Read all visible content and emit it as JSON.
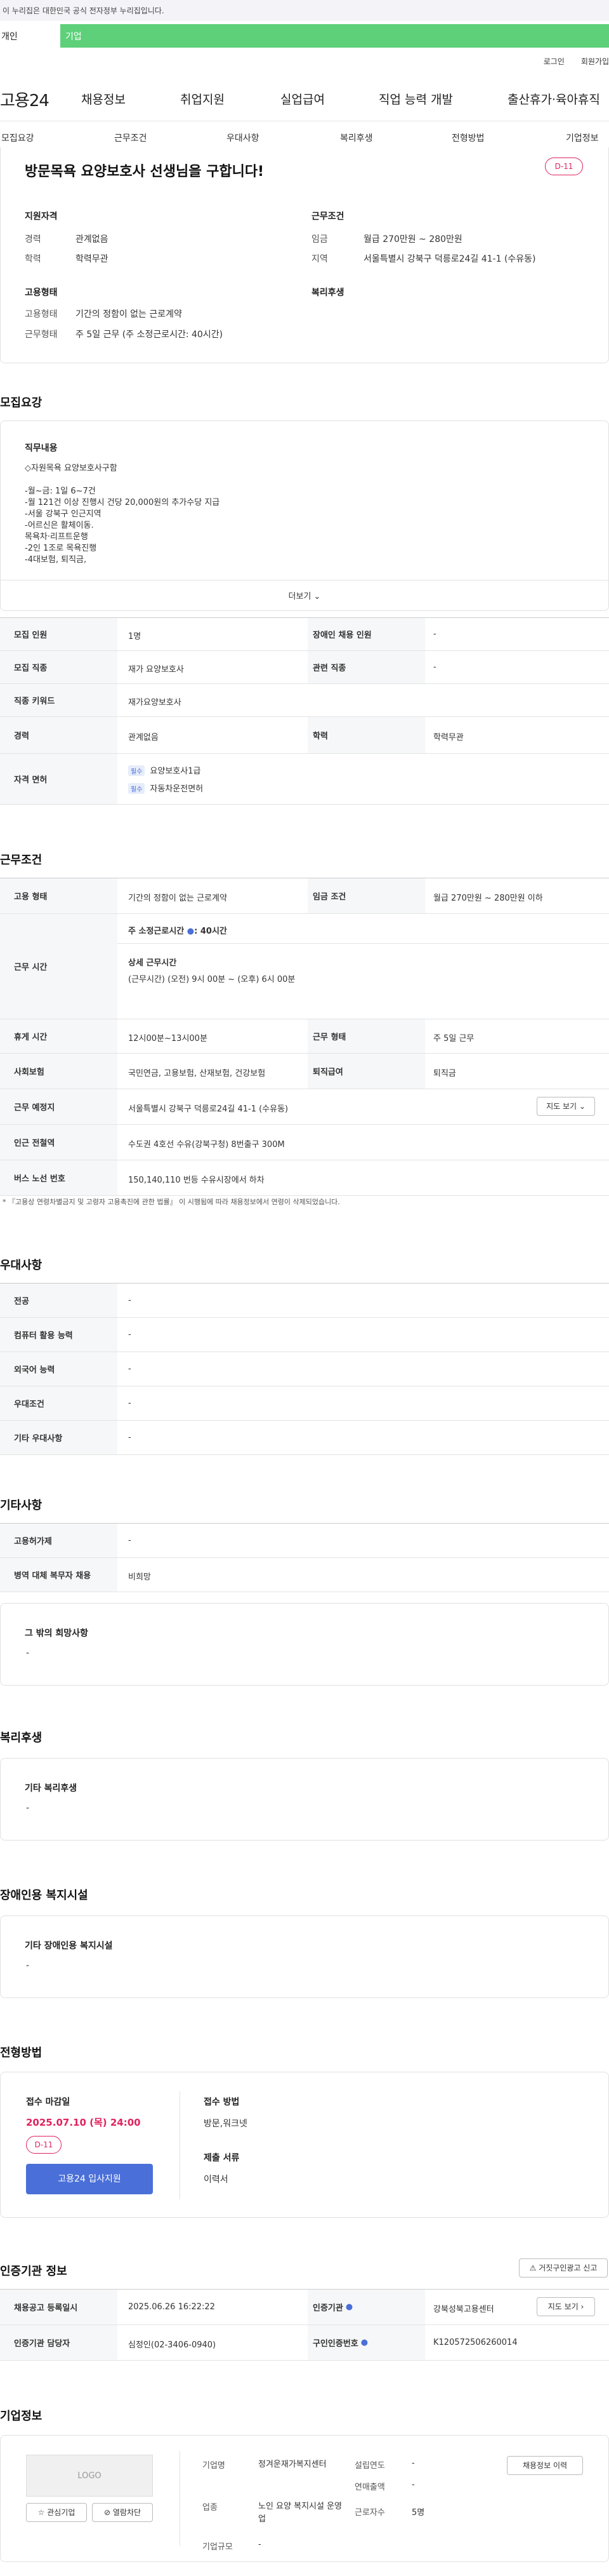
{
  "gov_banner": "이 누리집은 대한민국 공식 전자정부 누리집입니다.",
  "gnb": {
    "left": "개인",
    "right": "기업"
  },
  "util": [
    "로그인",
    "회원가입"
  ],
  "logo": "고용24",
  "menu": [
    "채용정보",
    "취업지원",
    "실업급여",
    "직업 능력 개발",
    "출산휴가·육아휴직"
  ],
  "tabs": [
    "모집요강",
    "근무조건",
    "우대사항",
    "복리후생",
    "전형방법",
    "기업정보"
  ],
  "job": {
    "title": "방문목욕 요양보호사 선생님을 구합니다!",
    "dday": "D-11",
    "qual_title": "지원자격",
    "cond_title": "근무조건",
    "emp_title": "고용형태",
    "welfare_title": "복리후생",
    "career_label": "경력",
    "career": "관계없음",
    "edu_label": "학력",
    "edu": "학력무관",
    "wage_label": "임금",
    "wage": "월급 270만원 ~ 280만원",
    "area_label": "지역",
    "area": "서울특별시 강북구 덕릉로24길 41-1 (수유동)",
    "emptype_label": "고용형태",
    "emptype": "기간의 정함이 없는 근로계약",
    "worktype_label": "근무형태",
    "worktype": "주 5일 근무 (주 소정근로시간: 40시간)"
  },
  "recruit": {
    "section": "모집요강",
    "duty_title": "직무내용",
    "duty_lines": [
      "◇자원목욕 요양보호사구함",
      "",
      "-월~금: 1일 6~7건",
      "-월 121건 이상 진행시 건당 20,000원의 추가수당 지급",
      "-서울 강북구 인근지역",
      "-어르신은 활체이동.",
      "목욕차·리프트운행",
      "-2인 1조로 목욕진행",
      "-4대보험, 퇴직금,"
    ],
    "more": "더보기",
    "rows": [
      {
        "k": "모집 인원",
        "v": "1명",
        "k2": "장애인 채용 인원",
        "v2": "-"
      },
      {
        "k": "모집 직종",
        "v": "재가 요양보호사",
        "k2": "관련 직종",
        "v2": "-"
      },
      {
        "k": "직종 키워드",
        "v": "재가요양보호사"
      },
      {
        "k": "경력",
        "v": "관계없음",
        "k2": "학력",
        "v2": "학력무관"
      }
    ],
    "license_label": "자격 면허",
    "license_badge1": "필수",
    "license1": "요양보호사1급",
    "license_badge2": "필수",
    "license2": "자동차운전면허"
  },
  "cond": {
    "section": "근무조건",
    "emp_label": "고용 형태",
    "emp": "기간의 정함이 없는 근로계약",
    "wage_label": "임금 조건",
    "wage": "월급 270만원 ~ 280만원 이하",
    "time_label": "근무 시간",
    "time_week": "주 소정근로시간",
    "time_week_val": "40시간",
    "time_detail_title": "상세 근무시간",
    "time_detail": "(근무시간) (오전) 9시 00분 ~ (오후) 6시 00분",
    "rest_label": "휴게 시간",
    "rest": "12시00분~13시00분",
    "form_label": "근무 형태",
    "form": "주 5일 근무",
    "ins_label": "사회보험",
    "ins": "국민연금, 고용보험, 산재보험, 건강보험",
    "ret_label": "퇴직급여",
    "ret": "퇴직금",
    "place_label": "근무 예정지",
    "place": "서울특별시 강북구 덕릉로24길 41-1 (수유동)",
    "map_btn": "지도 보기",
    "sub_label": "인근 전철역",
    "sub": "수도권 4호선 수유(강북구청) 8번출구 300M",
    "bus_label": "버스 노선 번호",
    "bus": "150,140,110 번등 수유시장에서 하차",
    "note": "* 『고용상 연령차별금지 및 고령자 고용촉진에 관한 법률』 이 시행됨에 따라 채용정보에서 연령이 삭제되었습니다."
  },
  "pref": {
    "section": "우대사항",
    "rows": [
      {
        "k": "전공",
        "v": "-"
      },
      {
        "k": "컴퓨터 활용 능력",
        "v": "-"
      },
      {
        "k": "외국어 능력",
        "v": "-"
      },
      {
        "k": "우대조건",
        "v": "-"
      },
      {
        "k": "기타 우대사항",
        "v": "-"
      }
    ]
  },
  "etc": {
    "section": "기타사항",
    "rows": [
      {
        "k": "고용허가제",
        "v": "-"
      },
      {
        "k": "병역 대체 복무자 채용",
        "v": "비희망"
      }
    ],
    "hope_title": "그 밖의 희망사항",
    "hope": "-"
  },
  "welfare": {
    "section": "복리후생",
    "title": "기타 복리후생",
    "val": "-"
  },
  "disab": {
    "section": "장애인용 복지시설",
    "title": "기타 장애인용 복지시설",
    "val": "-"
  },
  "sel": {
    "section": "전형방법",
    "deadline_title": "접수 마감일",
    "deadline": "2025.07.10 (목) 24:00",
    "dday": "D-11",
    "apply": "고용24 입사지원",
    "method_title": "접수 방법",
    "method": "방문,워크넷",
    "docs_title": "제출 서류",
    "docs": "이력서"
  },
  "agency": {
    "section": "인증기관 정보",
    "report": "거짓구인광고 신고",
    "reg_label": "채용공고 등록일시",
    "reg": "2025.06.26 16:22:22",
    "org_label": "인증기관",
    "org": "강북성북고용센터",
    "map_btn": "지도 보기",
    "mgr_label": "인증기관 담당자",
    "mgr": "심정인(02-3406-0940)",
    "num_label": "구인인증번호",
    "num": "K120572506260014"
  },
  "company": {
    "section": "기업정보",
    "logo": "LOGO",
    "fav": "관심기업",
    "block": "열람차단",
    "name_label": "기업명",
    "name": "정겨운재가복지센터",
    "year_label": "설립연도",
    "year": "-",
    "sales_label": "연매출액",
    "sales": "-",
    "ind_label": "업종",
    "ind": "노인 요양 복지시설 운영업",
    "emp_label": "근로자수",
    "emp": "5명",
    "size_label": "기업규모",
    "size": "-",
    "list_btn": "채용정보 이력"
  }
}
